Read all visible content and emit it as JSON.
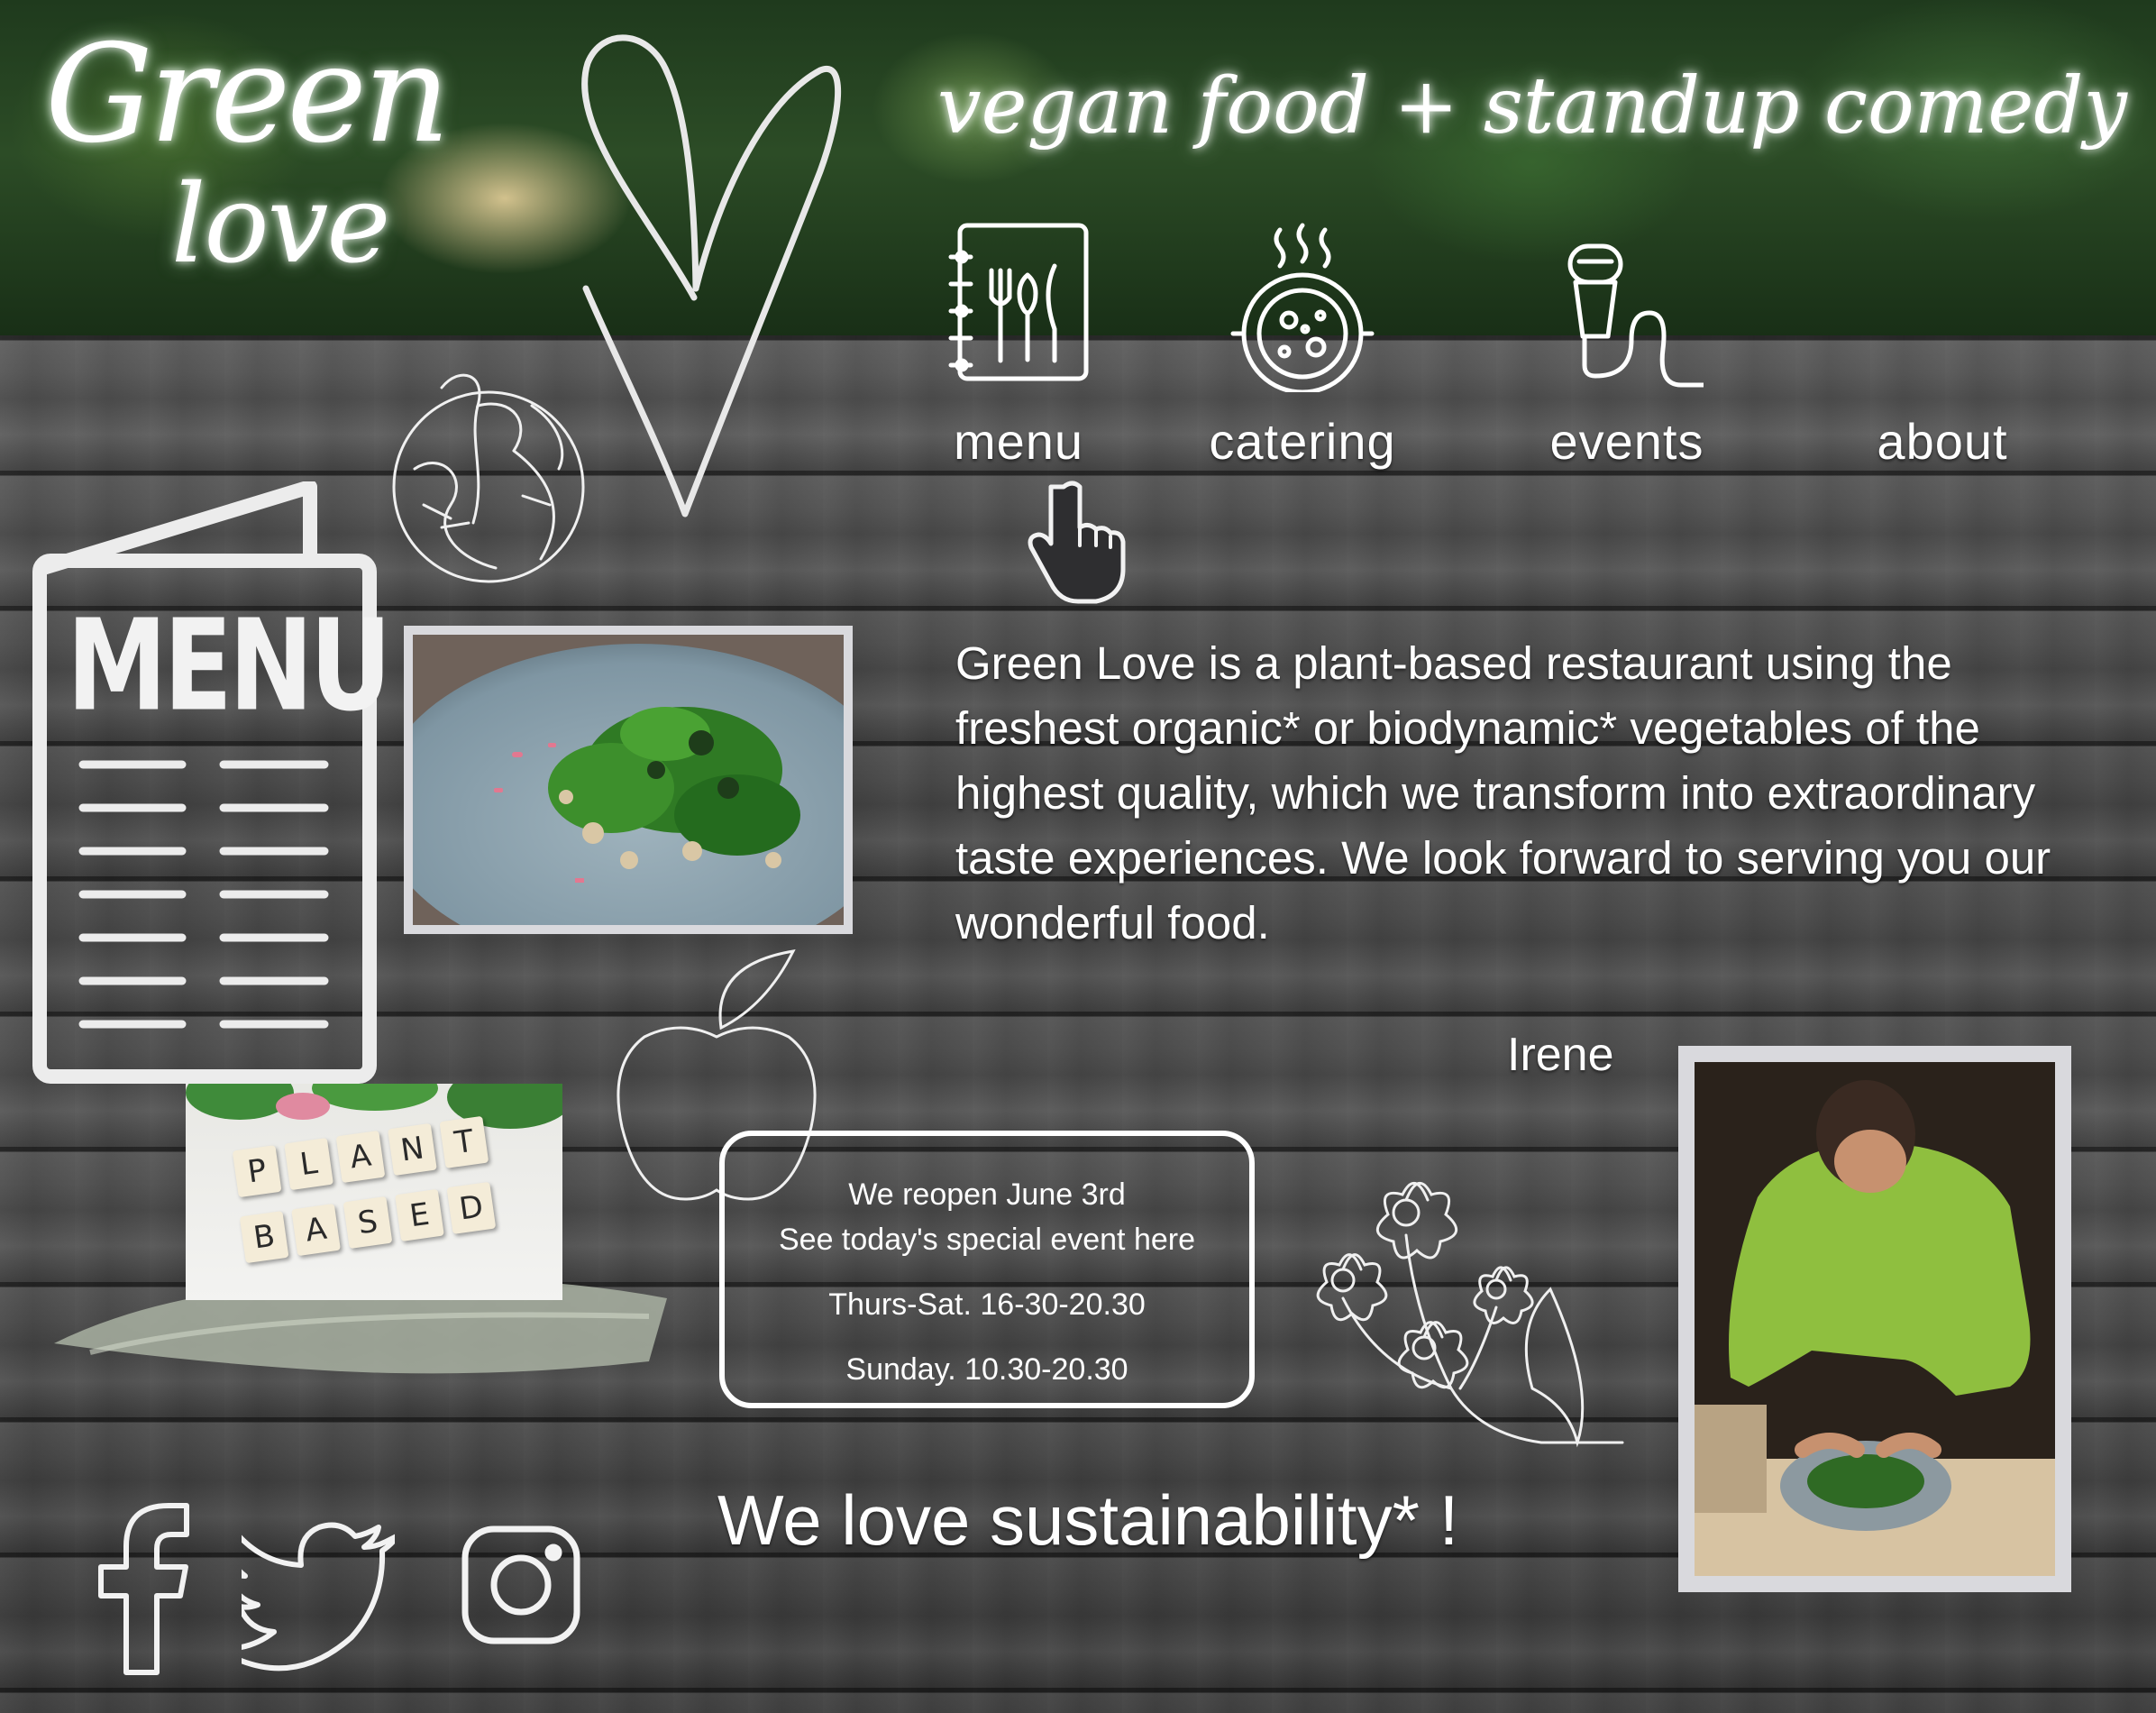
{
  "brand": {
    "logo_line1": "Green",
    "logo_line2": "love",
    "tagline": "vegan food + standup comedy"
  },
  "nav": [
    {
      "label": "menu",
      "icon": "menu-book-icon"
    },
    {
      "label": "catering",
      "icon": "soup-pot-icon"
    },
    {
      "label": "events",
      "icon": "microphone-icon"
    },
    {
      "label": "about",
      "icon": ""
    }
  ],
  "menu_card": {
    "title": "MENU"
  },
  "plant_based": {
    "row1": [
      "P",
      "L",
      "A",
      "N",
      "T"
    ],
    "row2": [
      "B",
      "A",
      "S",
      "E",
      "D"
    ]
  },
  "intro": {
    "text": "Green Love is a plant-based restaurant using the freshest organic* or biodynamic* vegetables of the highest quality, which we transform into extraordinary taste experiences.  We look forward to serving you our wonderful food.",
    "signature": "Irene"
  },
  "info_box": {
    "line1": "We reopen June 3rd",
    "line2": "See today's special event here",
    "line3": "Thurs-Sat. 16-30-20.30",
    "line4": "Sunday. 10.30-20.30"
  },
  "sustainability": "We love sustainability* !",
  "social": [
    {
      "icon": "facebook-icon"
    },
    {
      "icon": "twitter-icon"
    },
    {
      "icon": "instagram-icon"
    }
  ],
  "colors": {
    "text": "#ffffff",
    "wood": "#4a4a4a",
    "leaf_green": "#2c4c26",
    "shirt_green": "#8fbf3f",
    "photo_frame": "#d9d9dd"
  }
}
